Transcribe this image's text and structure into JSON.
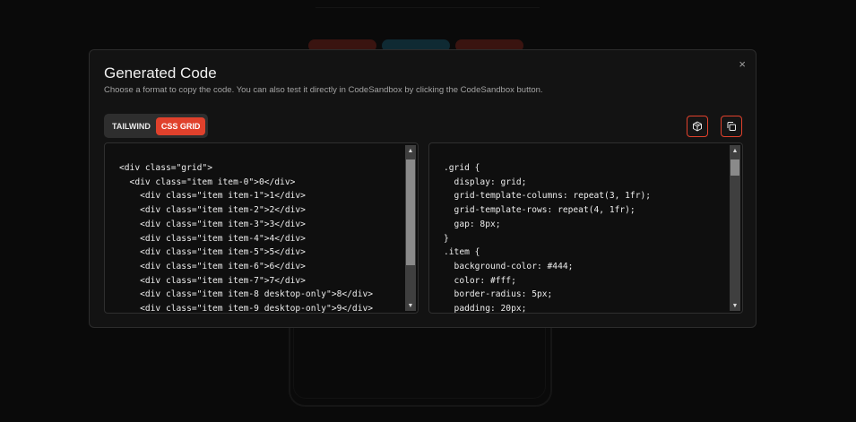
{
  "modal": {
    "title": "Generated Code",
    "subtitle": "Choose a format to copy the code. You can also test it directly in CodeSandbox by clicking the CodeSandbox button.",
    "close_label": "×"
  },
  "tabs": [
    {
      "label": "TAILWIND",
      "active": false
    },
    {
      "label": "CSS GRID",
      "active": true
    }
  ],
  "actions": {
    "codesandbox_icon": "codesandbox-icon",
    "copy_icon": "copy-icon"
  },
  "html_code": [
    "<div class=\"grid\">",
    "  <div class=\"item item-0\">0</div>",
    "    <div class=\"item item-1\">1</div>",
    "    <div class=\"item item-2\">2</div>",
    "    <div class=\"item item-3\">3</div>",
    "    <div class=\"item item-4\">4</div>",
    "    <div class=\"item item-5\">5</div>",
    "    <div class=\"item item-6\">6</div>",
    "    <div class=\"item item-7\">7</div>",
    "    <div class=\"item item-8 desktop-only\">8</div>",
    "    <div class=\"item item-9 desktop-only\">9</div>"
  ],
  "css_code": [
    ".grid {",
    "  display: grid;",
    "  grid-template-columns: repeat(3, 1fr);",
    "  grid-template-rows: repeat(4, 1fr);",
    "  gap: 8px;",
    "}",
    ".item {",
    "  background-color: #444;",
    "  color: #fff;",
    "  border-radius: 5px;",
    "  padding: 20px;"
  ],
  "scroll": {
    "up_arrow": "▲",
    "down_arrow": "▼"
  },
  "colors": {
    "accent": "#e0412c",
    "modal_bg": "#131313",
    "panel_bg": "#0f0f0f"
  }
}
